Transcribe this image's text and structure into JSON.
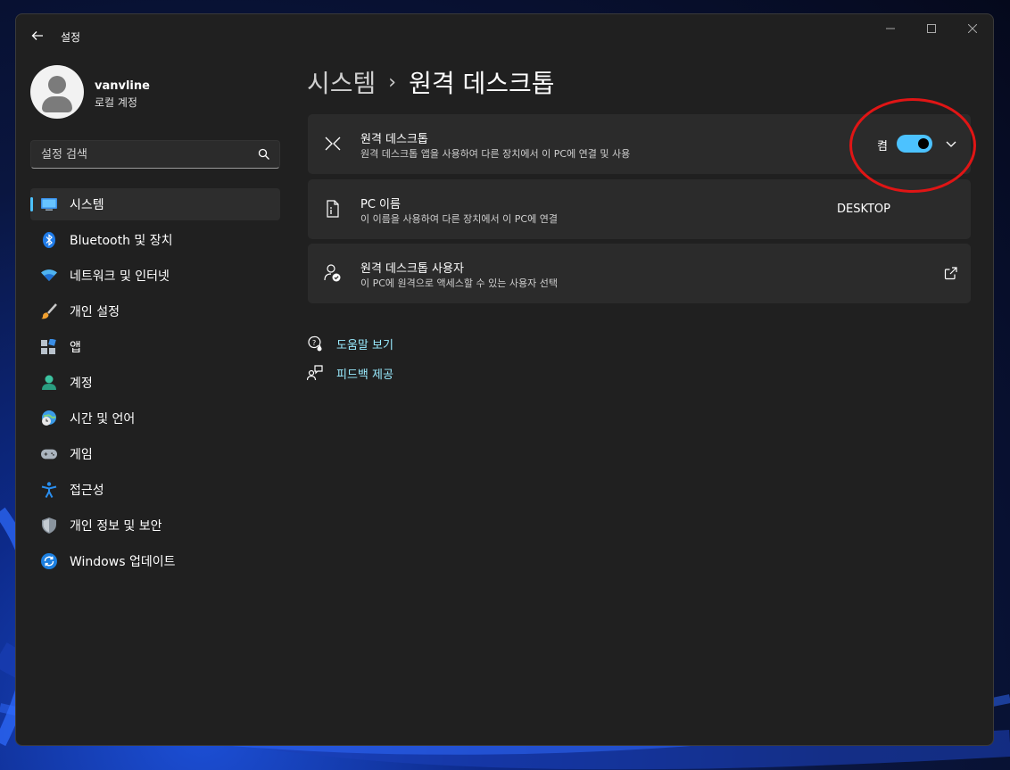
{
  "window": {
    "title": "설정",
    "controls": {
      "minimize": "minimize-icon",
      "maximize": "maximize-icon",
      "close": "close-icon"
    }
  },
  "user": {
    "name": "vanvline",
    "account_type": "로컬 계정"
  },
  "search": {
    "placeholder": "설정 검색",
    "value": ""
  },
  "sidebar": {
    "items": [
      {
        "label": "시스템",
        "icon": "monitor-icon",
        "active": true
      },
      {
        "label": "Bluetooth 및 장치",
        "icon": "bluetooth-icon",
        "active": false
      },
      {
        "label": "네트워크 및 인터넷",
        "icon": "wifi-icon",
        "active": false
      },
      {
        "label": "개인 설정",
        "icon": "brush-icon",
        "active": false
      },
      {
        "label": "앱",
        "icon": "apps-icon",
        "active": false
      },
      {
        "label": "계정",
        "icon": "account-icon",
        "active": false
      },
      {
        "label": "시간 및 언어",
        "icon": "globe-clock-icon",
        "active": false
      },
      {
        "label": "게임",
        "icon": "gamepad-icon",
        "active": false
      },
      {
        "label": "접근성",
        "icon": "accessibility-icon",
        "active": false
      },
      {
        "label": "개인 정보 및 보안",
        "icon": "shield-icon",
        "active": false
      },
      {
        "label": "Windows 업데이트",
        "icon": "update-icon",
        "active": false
      }
    ]
  },
  "breadcrumb": {
    "parent": "시스템",
    "separator": "›",
    "current": "원격 데스크톱"
  },
  "cards": {
    "remote_desktop": {
      "title": "원격 데스크톱",
      "subtitle": "원격 데스크톱 앱을 사용하여 다른 장치에서 이 PC에 연결 및 사용",
      "toggle_label": "켬",
      "toggle_on": true
    },
    "pc_name": {
      "title": "PC 이름",
      "subtitle": "이 이름을 사용하여 다른 장치에서 이 PC에 연결",
      "value": "DESKTOP"
    },
    "users": {
      "title": "원격 데스크톱 사용자",
      "subtitle": "이 PC에 원격으로 액세스할 수 있는 사용자 선택"
    }
  },
  "links": {
    "help": "도움말 보기",
    "feedback": "피드백 제공"
  },
  "colors": {
    "accent": "#4cc2ff",
    "link": "#99ebff",
    "window_bg": "#202020",
    "card_bg": "#2b2b2b",
    "annotation": "#e01515"
  }
}
